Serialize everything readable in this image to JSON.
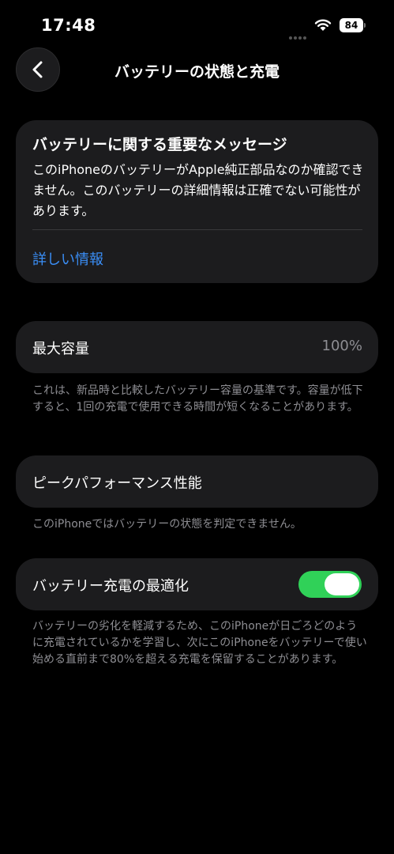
{
  "status_bar": {
    "time": "17:48",
    "battery": "84"
  },
  "nav": {
    "title": "バッテリーの状態と充電"
  },
  "important_message": {
    "title": "バッテリーに関する重要なメッセージ",
    "body": "このiPhoneのバッテリーがApple純正部品なのか確認できません。このバッテリーの詳細情報は正確でない可能性があります。",
    "link": "詳しい情報"
  },
  "maximum_capacity": {
    "label": "最大容量",
    "value": "100%",
    "footnote": "これは、新品時と比較したバッテリー容量の基準です。容量が低下すると、1回の充電で使用できる時間が短くなることがあります。"
  },
  "peak_performance": {
    "label": "ピークパフォーマンス性能",
    "footnote": "このiPhoneではバッテリーの状態を判定できません。"
  },
  "optimized_charging": {
    "label": "バッテリー充電の最適化",
    "enabled": true,
    "footnote": "バッテリーの劣化を軽減するため、このiPhoneが日ごろどのように充電されているかを学習し、次にこのiPhoneをバッテリーで使い始める直前まで80%を超える充電を保留することがあります。"
  },
  "colors": {
    "accent_link": "#3a8ef6",
    "toggle_on": "#30d158",
    "card_bg": "#1c1c1e"
  },
  "icons": {
    "back": "chevron-left-icon",
    "wifi": "wifi-icon",
    "battery": "battery-icon"
  }
}
